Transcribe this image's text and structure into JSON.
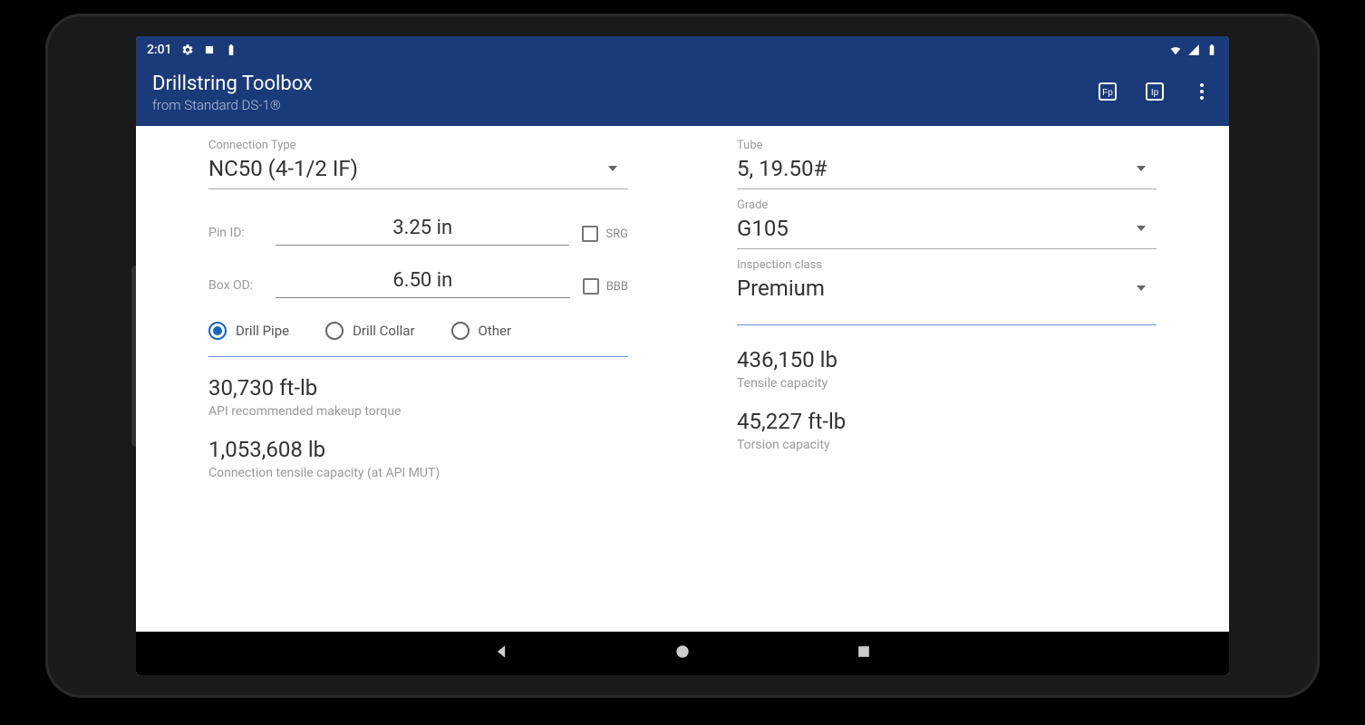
{
  "status": {
    "time": "2:01"
  },
  "appbar": {
    "title": "Drillstring Toolbox",
    "subtitle": "from Standard DS-1®"
  },
  "left": {
    "connection_type_label": "Connection Type",
    "connection_type_value": "NC50 (4-1/2 IF)",
    "pin_id_label": "Pin ID:",
    "pin_id_value": "3.25 in",
    "pin_chk_label": "SRG",
    "box_od_label": "Box OD:",
    "box_od_value": "6.50 in",
    "box_chk_label": "BBB",
    "radios": {
      "drill_pipe": "Drill Pipe",
      "drill_collar": "Drill Collar",
      "other": "Other"
    },
    "result1_value": "30,730 ft-lb",
    "result1_desc": "API recommended makeup torque",
    "result2_value": "1,053,608 lb",
    "result2_desc": "Connection tensile capacity (at API MUT)"
  },
  "right": {
    "tube_label": "Tube",
    "tube_value": "5, 19.50#",
    "grade_label": "Grade",
    "grade_value": "G105",
    "inspection_label": "Inspection class",
    "inspection_value": "Premium",
    "result1_value": "436,150 lb",
    "result1_desc": "Tensile capacity",
    "result2_value": "45,227 ft-lb",
    "result2_desc": "Torsion capacity"
  }
}
